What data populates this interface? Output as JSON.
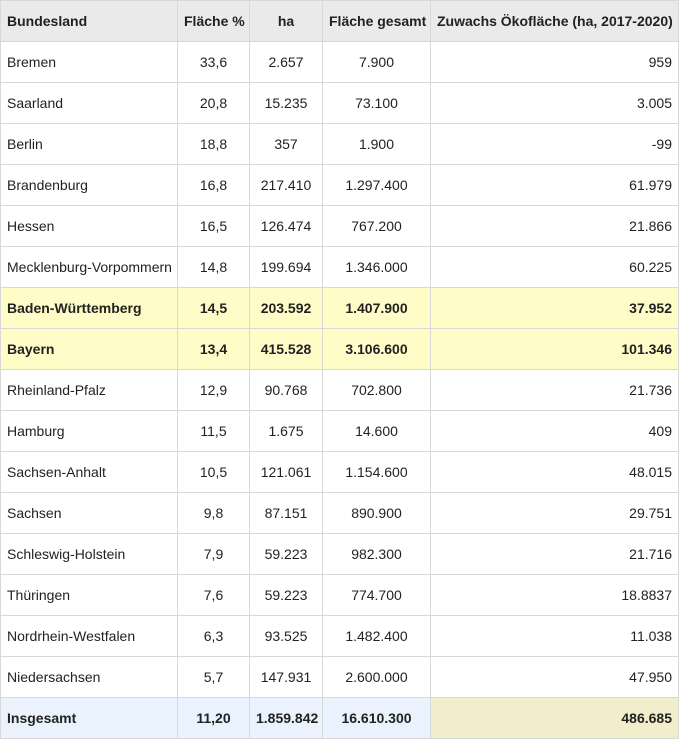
{
  "table": {
    "headers": [
      "Bundesland",
      "Fläche %",
      "ha",
      "Fläche gesamt",
      "Zuwachs Ökofläche (ha, 2017-2020)"
    ],
    "rows": [
      [
        "Bremen",
        "33,6",
        "2.657",
        "7.900",
        "959"
      ],
      [
        "Saarland",
        "20,8",
        "15.235",
        "73.100",
        "3.005"
      ],
      [
        "Berlin",
        "18,8",
        "357",
        "1.900",
        "-99"
      ],
      [
        "Brandenburg",
        "16,8",
        "217.410",
        "1.297.400",
        "61.979"
      ],
      [
        "Hessen",
        "16,5",
        "126.474",
        "767.200",
        "21.866"
      ],
      [
        "Mecklenburg-Vorpommern",
        "14,8",
        "199.694",
        "1.346.000",
        "60.225"
      ],
      [
        "Baden-Württemberg",
        "14,5",
        "203.592",
        "1.407.900",
        "37.952"
      ],
      [
        "Bayern",
        "13,4",
        "415.528",
        "3.106.600",
        "101.346"
      ],
      [
        "Rheinland-Pfalz",
        "12,9",
        "90.768",
        "702.800",
        "21.736"
      ],
      [
        "Hamburg",
        "11,5",
        "1.675",
        "14.600",
        "409"
      ],
      [
        "Sachsen-Anhalt",
        "10,5",
        "121.061",
        "1.154.600",
        "48.015"
      ],
      [
        "Sachsen",
        "9,8",
        "87.151",
        "890.900",
        "29.751"
      ],
      [
        "Schleswig-Holstein",
        "7,9",
        "59.223",
        "982.300",
        "21.716"
      ],
      [
        "Thüringen",
        "7,6",
        "59.223",
        "774.700",
        "18.8837"
      ],
      [
        "Nordrhein-Westfalen",
        "6,3",
        "93.525",
        "1.482.400",
        "11.038"
      ],
      [
        "Niedersachsen",
        "5,7",
        "147.931",
        "2.600.000",
        "47.950"
      ]
    ],
    "total": [
      "Insgesamt",
      "11,20",
      "1.859.842",
      "16.610.300",
      "486.685"
    ],
    "colors": {
      "header_bg": "#eaeaea",
      "highlight_bg": "#fffcc8",
      "total_bg": "#eaf3fd",
      "total_last_bg": "#f2eecb",
      "border": "#d8d8d8"
    }
  }
}
